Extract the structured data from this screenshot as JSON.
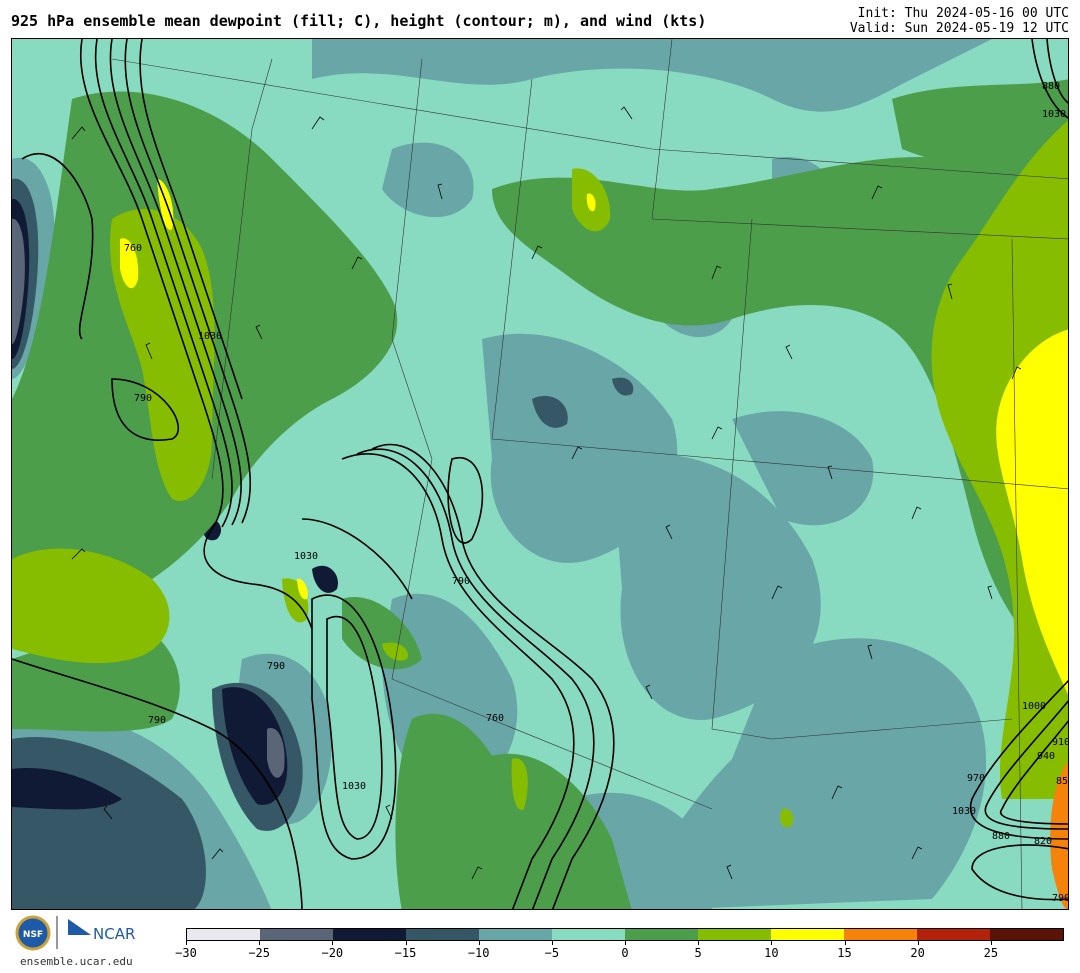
{
  "header": {
    "title": "925 hPa ensemble mean dewpoint (fill; C), height (contour; m), and wind (kts)",
    "init": "Init: Thu 2024-05-16 00 UTC",
    "valid": "Valid: Sun 2024-05-19 12 UTC"
  },
  "footer": {
    "site": "ensemble.ucar.edu",
    "logo_text_nsf": "NSF",
    "logo_text_ncar": "NCAR"
  },
  "colorbar": {
    "ticks": [
      "−30",
      "−25",
      "−20",
      "−15",
      "−10",
      "−5",
      "0",
      "5",
      "10",
      "15",
      "20",
      "25"
    ],
    "colors": [
      "#e8e8ee",
      "#5a6678",
      "#111a34",
      "#365766",
      "#69a6a8",
      "#88dbc0",
      "#4d9e4b",
      "#87bd00",
      "#ffff00",
      "#f5820a",
      "#b3230c",
      "#5a1307"
    ]
  },
  "map": {
    "contour_labels": [
      "790",
      "760",
      "1030",
      "790",
      "790",
      "1030",
      "1030",
      "790",
      "760",
      "1030",
      "1000",
      "970",
      "940",
      "910",
      "880",
      "850",
      "820",
      "790",
      "880",
      "1030"
    ]
  }
}
